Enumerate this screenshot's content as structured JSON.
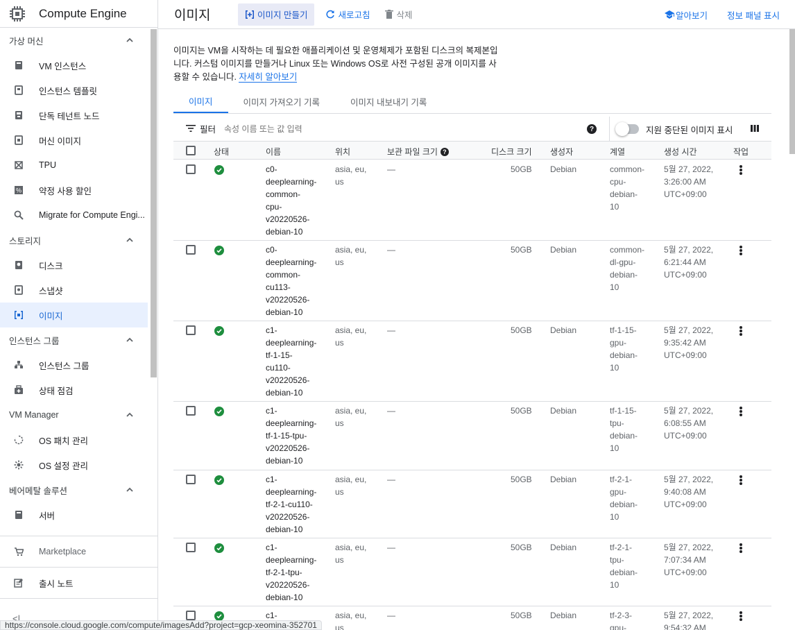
{
  "app": {
    "title": "Compute Engine"
  },
  "sidebar": {
    "sections": [
      {
        "label": "가상 머신",
        "items": [
          {
            "label": "VM 인스턴스",
            "icon": "vm-icon"
          },
          {
            "label": "인스턴스 템플릿",
            "icon": "template-icon"
          },
          {
            "label": "단독 테넌트 노드",
            "icon": "node-icon"
          },
          {
            "label": "머신 이미지",
            "icon": "machine-image-icon"
          },
          {
            "label": "TPU",
            "icon": "tpu-icon"
          },
          {
            "label": "약정 사용 할인",
            "icon": "percent-icon"
          },
          {
            "label": "Migrate for Compute Engi...",
            "icon": "search-icon"
          }
        ]
      },
      {
        "label": "스토리지",
        "items": [
          {
            "label": "디스크",
            "icon": "disk-icon"
          },
          {
            "label": "스냅샷",
            "icon": "snapshot-icon"
          },
          {
            "label": "이미지",
            "icon": "image-icon",
            "active": true
          }
        ]
      },
      {
        "label": "인스턴스 그룹",
        "items": [
          {
            "label": "인스턴스 그룹",
            "icon": "group-icon"
          },
          {
            "label": "상태 점검",
            "icon": "health-icon"
          }
        ]
      },
      {
        "label": "VM Manager",
        "items": [
          {
            "label": "OS 패치 관리",
            "icon": "patch-icon"
          },
          {
            "label": "OS 설정 관리",
            "icon": "settings-icon"
          }
        ]
      },
      {
        "label": "베어메탈 솔루션",
        "items": [
          {
            "label": "서버",
            "icon": "server-icon"
          }
        ]
      }
    ],
    "footer": [
      {
        "label": "Marketplace",
        "icon": "cart-icon"
      },
      {
        "label": "출시 노트",
        "icon": "notes-icon"
      }
    ],
    "collapse_glyph": "<|"
  },
  "topbar": {
    "page_title": "이미지",
    "create_label": "이미지 만들기",
    "refresh_label": "새로고침",
    "delete_label": "삭제",
    "learn_label": "알아보기",
    "info_panel_label": "정보 패널 표시"
  },
  "description": {
    "text": "이미지는 VM을 시작하는 데 필요한 애플리케이션 및 운영체제가 포함된 디스크의 복제본입니다. 커스텀 이미지를 만들거나 Linux 또는 Windows OS로 사전 구성된 공개 이미지를 사용할 수 있습니다.",
    "link": "자세히 알아보기"
  },
  "tabs": [
    {
      "label": "이미지",
      "active": true
    },
    {
      "label": "이미지 가져오기 기록"
    },
    {
      "label": "이미지 내보내기 기록"
    }
  ],
  "filter": {
    "label": "필터",
    "placeholder": "속성 이름 또는 값 입력",
    "help": "?",
    "toggle_label": "지원 중단된 이미지 표시"
  },
  "table": {
    "headers": {
      "status": "상태",
      "name": "이름",
      "location": "위치",
      "archive_size": "보관 파일 크기",
      "disk_size": "디스크 크기",
      "creator": "생성자",
      "family": "계열",
      "created": "생성 시간",
      "actions": "작업"
    },
    "rows": [
      {
        "name": "c0-deeplearning-common-cpu-v20220526-debian-10",
        "name_lines": [
          "c0-",
          "deeplearning-",
          "common-",
          "cpu-",
          "v20220526-",
          "debian-10"
        ],
        "location_lines": [
          "asia, eu,",
          "us"
        ],
        "archive": "—",
        "disk": "50GB",
        "creator": "Debian",
        "family_lines": [
          "common-",
          "cpu-",
          "debian-",
          "10"
        ],
        "created_lines": [
          "5월 27, 2022,",
          "3:26:00 AM",
          "UTC+09:00"
        ]
      },
      {
        "name": "c0-deeplearning-common-cu113-v20220526-debian-10",
        "name_lines": [
          "c0-",
          "deeplearning-",
          "common-",
          "cu113-",
          "v20220526-",
          "debian-10"
        ],
        "location_lines": [
          "asia, eu,",
          "us"
        ],
        "archive": "—",
        "disk": "50GB",
        "creator": "Debian",
        "family_lines": [
          "common-",
          "dl-gpu-",
          "debian-",
          "10"
        ],
        "created_lines": [
          "5월 27, 2022,",
          "6:21:44 AM",
          "UTC+09:00"
        ]
      },
      {
        "name": "c1-deeplearning-tf-1-15-cu110-v20220526-debian-10",
        "name_lines": [
          "c1-",
          "deeplearning-",
          "tf-1-15-",
          "cu110-",
          "v20220526-",
          "debian-10"
        ],
        "location_lines": [
          "asia, eu,",
          "us"
        ],
        "archive": "—",
        "disk": "50GB",
        "creator": "Debian",
        "family_lines": [
          "tf-1-15-",
          "gpu-",
          "debian-",
          "10"
        ],
        "created_lines": [
          "5월 27, 2022,",
          "9:35:42 AM",
          "UTC+09:00"
        ]
      },
      {
        "name": "c1-deeplearning-tf-1-15-tpu-v20220526-debian-10",
        "name_lines": [
          "c1-",
          "deeplearning-",
          "tf-1-15-tpu-",
          "v20220526-",
          "debian-10"
        ],
        "location_lines": [
          "asia, eu,",
          "us"
        ],
        "archive": "—",
        "disk": "50GB",
        "creator": "Debian",
        "family_lines": [
          "tf-1-15-",
          "tpu-",
          "debian-",
          "10"
        ],
        "created_lines": [
          "5월 27, 2022,",
          "6:08:55 AM",
          "UTC+09:00"
        ]
      },
      {
        "name": "c1-deeplearning-tf-2-1-cu110-v20220526-debian-10",
        "name_lines": [
          "c1-",
          "deeplearning-",
          "tf-2-1-cu110-",
          "v20220526-",
          "debian-10"
        ],
        "location_lines": [
          "asia, eu,",
          "us"
        ],
        "archive": "—",
        "disk": "50GB",
        "creator": "Debian",
        "family_lines": [
          "tf-2-1-",
          "gpu-",
          "debian-",
          "10"
        ],
        "created_lines": [
          "5월 27, 2022,",
          "9:40:08 AM",
          "UTC+09:00"
        ]
      },
      {
        "name": "c1-deeplearning-tf-2-1-tpu-v20220526-debian-10",
        "name_lines": [
          "c1-",
          "deeplearning-",
          "tf-2-1-tpu-",
          "v20220526-",
          "debian-10"
        ],
        "location_lines": [
          "asia, eu,",
          "us"
        ],
        "archive": "—",
        "disk": "50GB",
        "creator": "Debian",
        "family_lines": [
          "tf-2-1-",
          "tpu-",
          "debian-",
          "10"
        ],
        "created_lines": [
          "5월 27, 2022,",
          "7:07:34 AM",
          "UTC+09:00"
        ]
      },
      {
        "name": "c1-",
        "name_lines": [
          "c1-"
        ],
        "location_lines": [
          "asia, eu,",
          "us"
        ],
        "archive": "—",
        "disk": "50GB",
        "creator": "Debian",
        "family_lines": [
          "tf-2-3-",
          "gpu-"
        ],
        "created_lines": [
          "5월 27, 2022,",
          "9:54:32 AM"
        ]
      }
    ]
  },
  "status_bar": {
    "url": "https://console.cloud.google.com/compute/imagesAdd?project=gcp-xeomina-352701"
  },
  "colors": {
    "accent": "#1a73e8",
    "status_ok": "#1e8e3e",
    "active_bg": "#e8f0fe"
  }
}
